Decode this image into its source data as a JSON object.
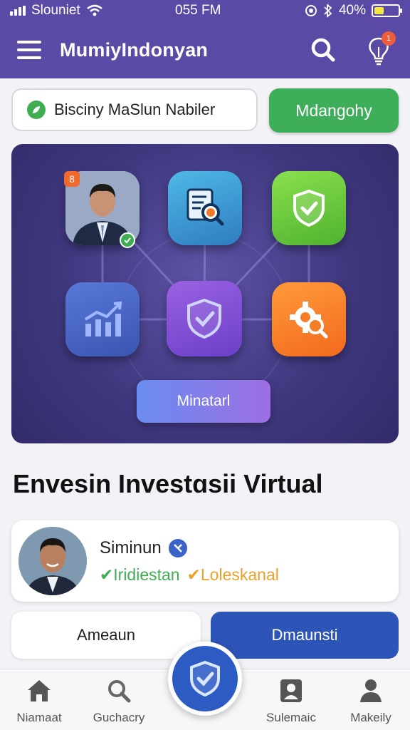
{
  "status_bar": {
    "carrier": "Slouniet",
    "time": "055 FM",
    "battery": "40%",
    "battery_level": 0.4
  },
  "app_bar": {
    "title": "MumiyIndonyan",
    "notification_count": "1"
  },
  "action_row": {
    "input_value": "Bisciny  MaSlun Nabiler",
    "green_button": "Mdangohy"
  },
  "hero": {
    "avatar_badge": "8",
    "button_label": "Minatarl"
  },
  "section_title": "Envesin Investɑsii Virtual",
  "user_card": {
    "name": "Siminun",
    "tag_green": "✔Iridiestan",
    "tag_orange": "✔Loleskanal"
  },
  "buttons": {
    "secondary": "Ameaun",
    "primary": "Dmaunsti"
  },
  "bottom_nav": {
    "items": [
      {
        "label": "Niamaat",
        "icon": "home-icon"
      },
      {
        "label": "Guchacry",
        "icon": "search-icon"
      },
      {
        "label": "Sulemaic",
        "icon": "contact-card-icon"
      },
      {
        "label": "Makeily",
        "icon": "person-icon"
      }
    ],
    "center_icon": "shield-check-icon"
  },
  "colors": {
    "brand": "#5a4aa6",
    "green": "#3fae5a",
    "blue": "#2d55b8"
  }
}
